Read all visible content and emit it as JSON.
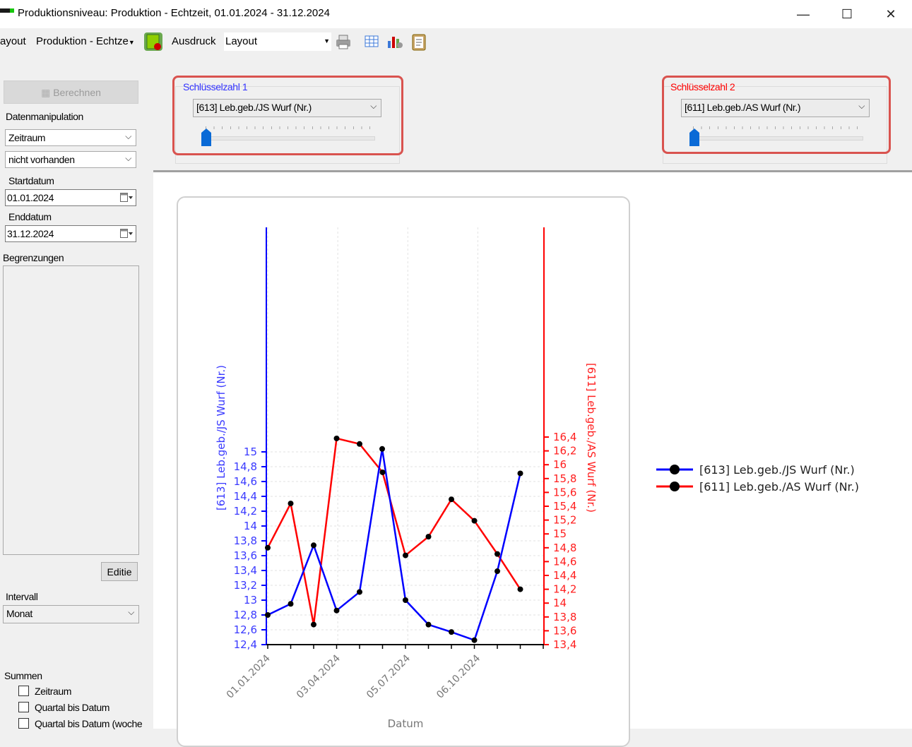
{
  "window": {
    "title": "Produktionsniveau: Produktion - Echtzeit, 01.01.2024 - 31.12.2024",
    "minimize_glyph": "—",
    "maximize_glyph": "☐",
    "close_glyph": "✕"
  },
  "toolbar": {
    "layout_partial": "ayout",
    "view_dropdown": "Produktion - Echtze",
    "print_label": "Ausdruck",
    "layout_dropdown": "Layout",
    "icons": [
      "calculate-icon",
      "printer-icon",
      "table-icon",
      "chart-settings-icon",
      "clipboard-icon"
    ]
  },
  "left_panel": {
    "calc_button": "Berechnen",
    "data_manipulation_label": "Datenmanipulation",
    "range_select": "Zeitraum",
    "availability_select": "nicht vorhanden",
    "start_label": "Startdatum",
    "start_value": "01.01.2024",
    "end_label": "Enddatum",
    "end_value": "31.12.2024",
    "limits_label": "Begrenzungen",
    "edit_button": "Editie",
    "interval_label": "Intervall",
    "interval_select": "Monat",
    "sums_label": "Summen",
    "sums_options": [
      "Zeitraum",
      "Quartal bis Datum",
      "Quartal bis Datum (woche"
    ]
  },
  "key1": {
    "legend": "Schlüsselzahl 1",
    "select": "[613] Leb.geb./JS Wurf (Nr.)",
    "slider_position": 0,
    "color": "#3333ff"
  },
  "key2": {
    "legend": "Schlüsselzahl 2",
    "select": "[611] Leb.geb./AS Wurf (Nr.)",
    "slider_position": 0,
    "color": "#ff0000"
  },
  "chart_data": {
    "type": "line",
    "xlabel": "Datum",
    "x_tick_labels": [
      "01.01.2024",
      "03.04.2024",
      "05.07.2024",
      "06.10.2024"
    ],
    "x": [
      "01.01.2024",
      "01.02.2024",
      "01.03.2024",
      "01.04.2024",
      "01.05.2024",
      "01.06.2024",
      "01.07.2024",
      "01.08.2024",
      "01.09.2024",
      "01.10.2024",
      "01.11.2024",
      "01.12.2024"
    ],
    "grid": true,
    "legend_position": "right",
    "y_left": {
      "label": "[613] Leb.geb./JS Wurf (Nr.)",
      "lim": [
        12.4,
        15.2
      ],
      "ticks": [
        "12,4",
        "12,6",
        "12,8",
        "13",
        "13,2",
        "13,4",
        "13,6",
        "13,8",
        "14",
        "14,2",
        "14,4",
        "14,6",
        "14,8",
        "15"
      ],
      "color": "#0000ff"
    },
    "y_right": {
      "label": "[611] Leb.geb./AS Wurf (Nr.)",
      "lim": [
        13.4,
        16.4
      ],
      "ticks": [
        "13,4",
        "13,6",
        "13,8",
        "14",
        "14,2",
        "14,4",
        "14,6",
        "14,8",
        "15",
        "15,2",
        "15,4",
        "15,6",
        "15,8",
        "16",
        "16,2",
        "16,4"
      ],
      "color": "#ff0000"
    },
    "series": [
      {
        "name": "[613] Leb.geb./JS Wurf (Nr.)",
        "axis": "left",
        "color": "#0000ff",
        "x_index": [
          0,
          1,
          2,
          3,
          4,
          5,
          5.5,
          6,
          7,
          8,
          9,
          10,
          11
        ],
        "values": [
          12.8,
          12.95,
          13.74,
          12.86,
          13.11,
          15.04,
          13.0,
          12.67,
          12.57,
          12.46,
          13.39,
          14.71
        ]
      },
      {
        "name": "[611] Leb.geb./AS Wurf (Nr.)",
        "axis": "right",
        "color": "#ff0000",
        "values": [
          14.8,
          15.44,
          13.69,
          16.38,
          16.3,
          15.89,
          14.69,
          14.96,
          15.5,
          15.19,
          14.71,
          14.2
        ]
      }
    ]
  }
}
